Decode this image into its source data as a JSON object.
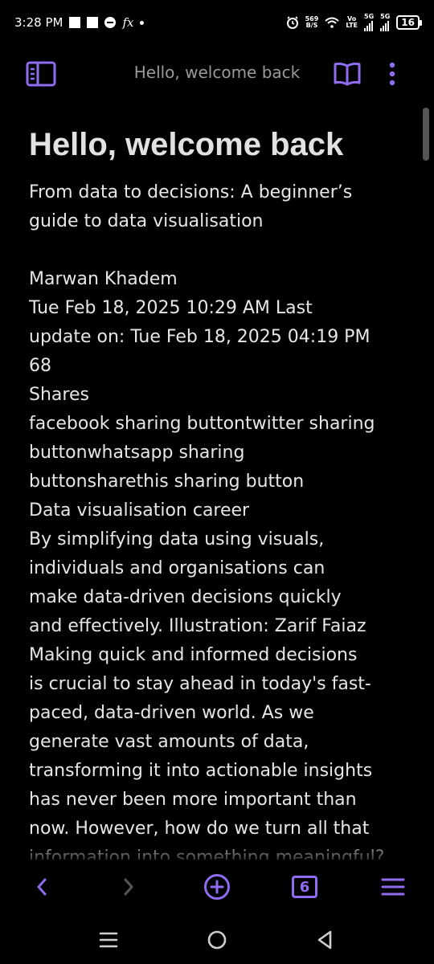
{
  "status_bar": {
    "time": "3:28 PM",
    "net_speed": "569",
    "net_unit": "B/S",
    "volte_top": "Vo",
    "volte_bottom": "LTE",
    "sim1": "5G",
    "sim2": "5G",
    "battery": "16"
  },
  "top_bar": {
    "title": "Hello, welcome back"
  },
  "article": {
    "headline": "Hello, welcome back",
    "lines": [
      "From data to decisions: A beginner’s",
      "guide to data visualisation",
      "",
      "Marwan Khadem",
      "Tue Feb 18, 2025 10:29 AM Last",
      "update on: Tue Feb 18, 2025 04:19 PM",
      "68",
      "Shares",
      "facebook sharing buttontwitter sharing",
      "buttonwhatsapp sharing",
      "buttonsharethis sharing button",
      "Data visualisation career",
      "By simplifying data using visuals,",
      "individuals and organisations can",
      "make data-driven decisions quickly",
      "and effectively. Illustration: Zarif Faiaz",
      "Making quick and informed decisions",
      "is crucial to stay ahead in today's fast-",
      "paced, data-driven world. As we",
      "generate vast amounts of data,",
      "transforming it into actionable insights",
      "has never been more important than",
      "now. However, how do we turn all that",
      "information into something meaningful?"
    ]
  },
  "toolbar": {
    "tab_count": "6"
  },
  "colors": {
    "accent": "#8f6cf0",
    "background": "#000000",
    "text": "#e6e6e6",
    "muted": "#9a9a9a"
  }
}
